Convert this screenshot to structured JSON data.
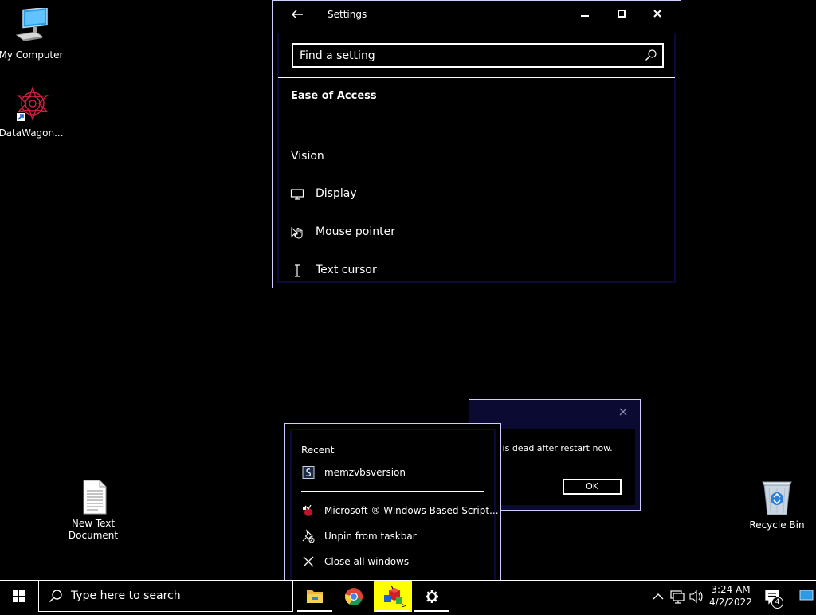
{
  "desktop": {
    "icons": [
      {
        "label": "My Computer"
      },
      {
        "label": "DataWagon..."
      },
      {
        "label": "New Text Document"
      },
      {
        "label": "Recycle Bin"
      }
    ]
  },
  "settings_window": {
    "title": "Settings",
    "search": {
      "placeholder": "Find a setting"
    },
    "section_title": "Ease of Access",
    "group_label": "Vision",
    "nav_items": [
      {
        "label": "Display",
        "icon": "monitor-icon"
      },
      {
        "label": "Mouse pointer",
        "icon": "mouse-pointer-icon"
      },
      {
        "label": "Text cursor",
        "icon": "text-cursor-icon"
      }
    ]
  },
  "message_box": {
    "text": "c is dead after restart now.",
    "ok_label": "OK"
  },
  "jump_list": {
    "heading": "Recent",
    "recent_items": [
      {
        "label": "memzvbsversion",
        "icon": "script-file-icon"
      }
    ],
    "app_items": [
      {
        "label": "Microsoft ® Windows Based Script...",
        "icon": "wscript-icon"
      },
      {
        "label": "Unpin from taskbar",
        "icon": "unpin-icon"
      },
      {
        "label": "Close all windows",
        "icon": "close-icon"
      }
    ]
  },
  "taskbar": {
    "search_placeholder": "Type here to search",
    "apps": [
      {
        "name": "File Explorer",
        "icon": "folder-icon"
      },
      {
        "name": "Google Chrome",
        "icon": "chrome-icon"
      },
      {
        "name": "Windows Based Script Host",
        "icon": "wscript-icon"
      },
      {
        "name": "Settings",
        "icon": "gear-icon"
      }
    ],
    "clock": {
      "time": "3:24 AM",
      "date": "4/2/2022"
    },
    "notification_count": "4"
  },
  "colors": {
    "background": "#000000",
    "border": "#cfcfff",
    "highlight": "#ffff00",
    "dialog_frame": "#0a0a33"
  }
}
